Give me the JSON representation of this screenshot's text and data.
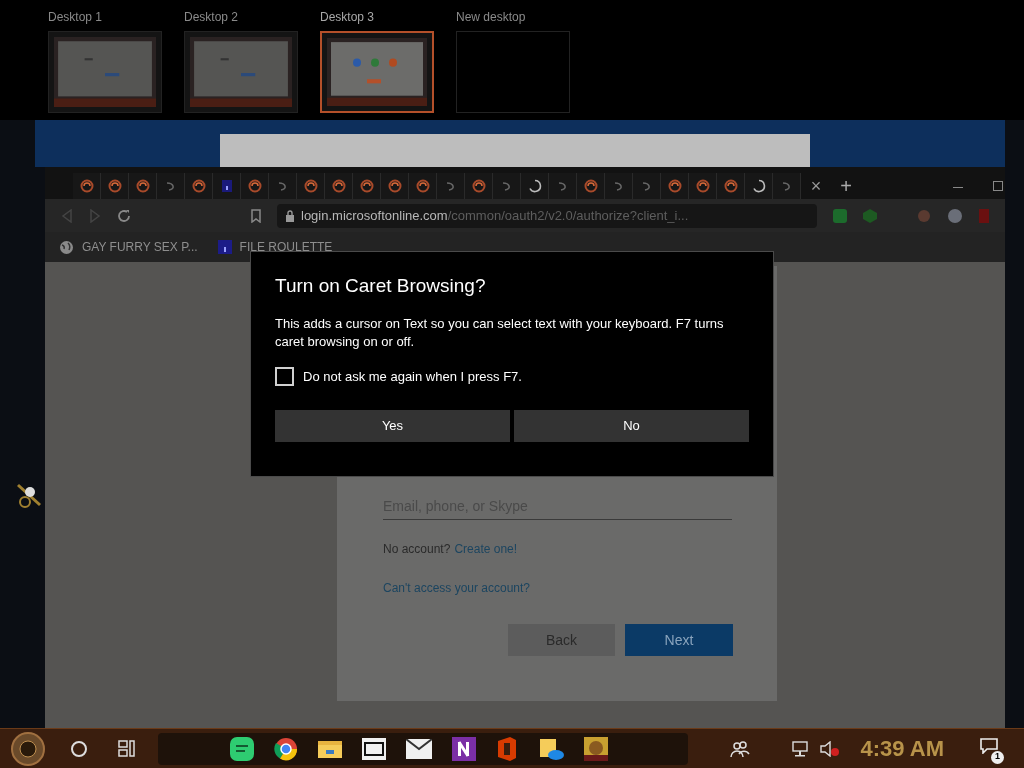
{
  "desktops": [
    {
      "label": "Desktop 1",
      "selected": false,
      "kind": "preview"
    },
    {
      "label": "Desktop 2",
      "selected": false,
      "kind": "preview"
    },
    {
      "label": "Desktop 3",
      "selected": true,
      "kind": "preview"
    },
    {
      "label": "New desktop",
      "selected": false,
      "kind": "empty"
    }
  ],
  "browser": {
    "tabs": [
      {
        "kind": "swirl"
      },
      {
        "kind": "swirl"
      },
      {
        "kind": "swirl"
      },
      {
        "kind": "hook"
      },
      {
        "kind": "swirl"
      },
      {
        "kind": "badge"
      },
      {
        "kind": "swirl"
      },
      {
        "kind": "hook"
      },
      {
        "kind": "swirl"
      },
      {
        "kind": "swirl"
      },
      {
        "kind": "swirl"
      },
      {
        "kind": "swirl"
      },
      {
        "kind": "swirl"
      },
      {
        "kind": "hook"
      },
      {
        "kind": "swirl"
      },
      {
        "kind": "hook"
      },
      {
        "kind": "spinner"
      },
      {
        "kind": "hook"
      },
      {
        "kind": "swirl"
      },
      {
        "kind": "hook"
      },
      {
        "kind": "hook"
      },
      {
        "kind": "swirl"
      },
      {
        "kind": "swirl"
      },
      {
        "kind": "swirl"
      },
      {
        "kind": "spinner"
      },
      {
        "kind": "hook"
      }
    ],
    "tab_close": "×",
    "new_tab": "+",
    "address": {
      "host": "login.microsoftonline.com",
      "path": "/common/oauth2/v2.0/authorize?client_i..."
    },
    "bookmarks": [
      {
        "label": "GAY FURRY SEX P...",
        "kind": "globe"
      },
      {
        "label": "FILE ROULETTE",
        "kind": "badge"
      }
    ]
  },
  "signin": {
    "placeholder": "Email, phone, or Skype",
    "no_account": "No account?",
    "create_link": "Create one!",
    "cant_access": "Can't access your account?",
    "back": "Back",
    "next": "Next"
  },
  "dialog": {
    "title": "Turn on Caret Browsing?",
    "body": "This adds a cursor on Text so you can select text with your keyboard. F7 turns caret browsing on or off.",
    "checkbox": {
      "label": "Do not ask me again when I press F7.",
      "checked": false
    },
    "buttons": [
      "Yes",
      "No"
    ]
  },
  "taskbar": {
    "clock": "4:39 AM",
    "notifications": "1",
    "volume_muted": true
  }
}
